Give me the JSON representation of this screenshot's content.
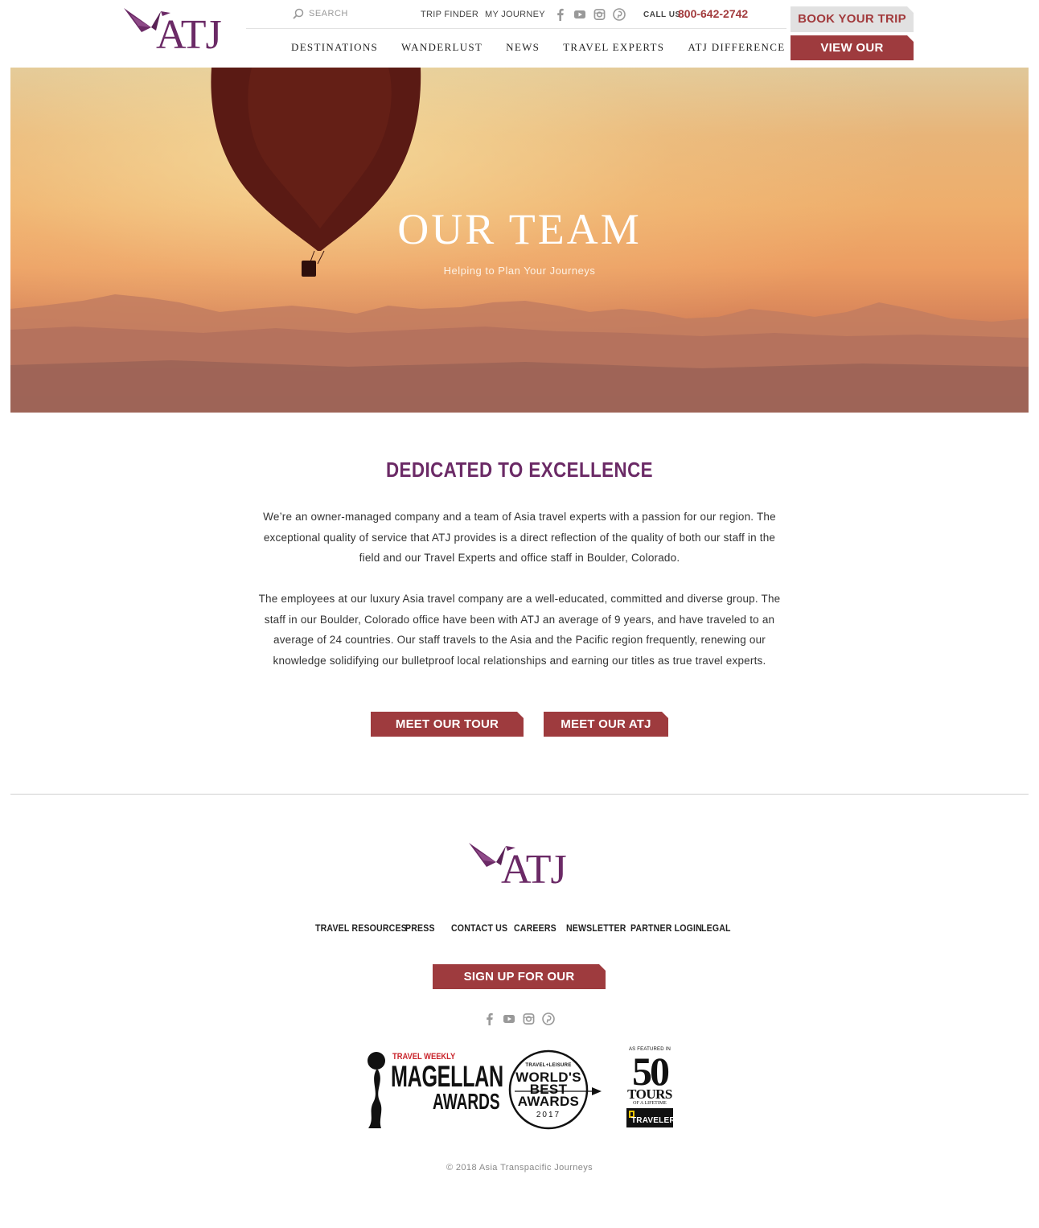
{
  "brand": {
    "logo_text": "ATJ",
    "primary_color": "#6b2a66",
    "accent_color": "#9e3b3e"
  },
  "header": {
    "search_placeholder": "SEARCH",
    "trip_finder": "TRIP FINDER",
    "my_journey": "MY JOURNEY",
    "social": [
      "facebook-icon",
      "youtube-icon",
      "instagram-icon",
      "pinterest-icon"
    ],
    "call_label": "CALL US",
    "phone": "800-642-2742",
    "book_trip": "BOOK YOUR TRIP",
    "catalog": "VIEW OUR CATALOG",
    "nav": [
      "DESTINATIONS",
      "WANDERLUST",
      "NEWS",
      "TRAVEL EXPERTS",
      "ATJ DIFFERENCE"
    ]
  },
  "hero": {
    "title": "OUR TEAM",
    "subtitle": "Helping to Plan Your Journeys"
  },
  "main": {
    "heading": "DEDICATED TO EXCELLENCE",
    "para1": "We’re an owner-managed company and a team of Asia travel experts with a passion for our region. The exceptional quality of service that ATJ provides is a direct reflection of the quality of both our staff in the field and our Travel Experts and office staff in Boulder, Colorado.",
    "para2": "The employees at our luxury Asia travel company are a well-educated, committed and diverse group. The staff in our Boulder, Colorado office have been with ATJ an average of 9 years, and have traveled to an average of 24 countries. Our staff travels to the Asia and the Pacific region frequently, renewing our knowledge solidifying our bulletproof local relationships and earning our titles as true travel experts.",
    "btn_leaders": "MEET OUR TOUR LEADERS",
    "btn_staff": "MEET OUR ATJ STAFF"
  },
  "footer": {
    "logo_text": "ATJ",
    "links": [
      "TRAVEL RESOURCES",
      "PRESS",
      "CONTACT US",
      "CAREERS",
      "NEWSLETTER",
      "PARTNER LOGIN",
      "LEGAL"
    ],
    "newsletter_btn": "SIGN UP FOR OUR NEWSLETTER",
    "awards": {
      "magellan_top": "TRAVEL WEEKLY",
      "magellan_main": "MAGELLAN",
      "magellan_sub": "AWARDS",
      "worlds_top": "TRAVEL+LEISURE",
      "worlds_line1": "WORLD'S",
      "worlds_line2": "BEST",
      "worlds_line3": "AWARDS",
      "worlds_year": "2017",
      "fifty_feat": "AS FEATURED IN",
      "fifty_num": "50",
      "fifty_tours": "TOURS",
      "fifty_life": "OF A LIFETIME",
      "fifty_brand": "TRAVELER"
    },
    "copyright": "© 2018 Asia Transpacific Journeys"
  }
}
